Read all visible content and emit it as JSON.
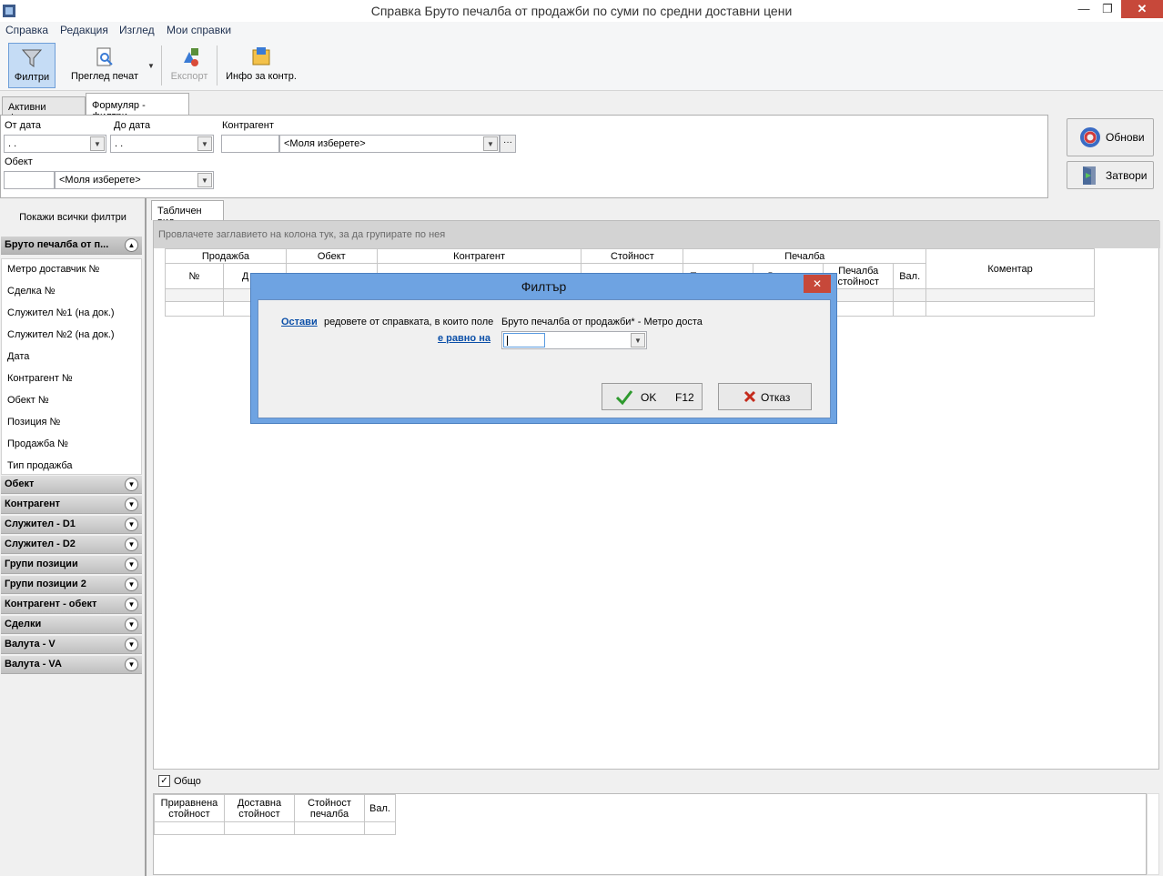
{
  "window": {
    "title": "Справка Бруто печалба от продажби по суми по средни доставни цени"
  },
  "menu": [
    "Справка",
    "Редакция",
    "Изглед",
    "Мои справки"
  ],
  "toolbar": {
    "filters": "Филтри",
    "print_preview": "Преглед печат",
    "export": "Експорт",
    "info": "Инфо за контр."
  },
  "tabs": {
    "active_filters": "Активни филтри",
    "form_filters": "Формуляр - филтри"
  },
  "form": {
    "from_date_label": "От дата",
    "from_date_value": " .  .",
    "to_date_label": "До дата",
    "to_date_value": " .  .",
    "partner_label": "Контрагент",
    "partner_value": "<Моля изберете>",
    "object_label": "Обект",
    "object_value": "<Моля изберете>"
  },
  "buttons": {
    "refresh": "Обнови",
    "close": "Затвори"
  },
  "left": {
    "show_all": "Покажи всички филтри",
    "expanded_group": "Бруто печалба от п...",
    "items": [
      "Метро доставчик №",
      "Сделка №",
      "Служител №1 (на док.)",
      "Служител №2 (на док.)",
      "Дата",
      "Контрагент №",
      "Обект №",
      "Позиция №",
      "Продажба №",
      "Тип продажба"
    ],
    "groups": [
      "Обект",
      "Контрагент",
      "Служител - D1",
      "Служител - D2",
      "Групи позиции",
      "Групи позиции 2",
      "Контрагент - обект",
      "Сделки",
      "Валута - V",
      "Валута - VA"
    ]
  },
  "grid": {
    "tab": "Табличен вид",
    "group_hint": "Провлачете заглавието на колона тук, за да групирате по нея",
    "h_sale": "Продажба",
    "h_object": "Обект",
    "h_partner": "Контрагент",
    "h_value": "Стойност",
    "h_profit": "Печалба",
    "h_comment": "Коментар",
    "h_no": "№",
    "h_d": "Д",
    "h_eq": "Приравнена",
    "h_deliv": "Доставна",
    "h_profit_value": "Печалба стойност",
    "h_cur": "Вал."
  },
  "dialog": {
    "title": "Филтър",
    "keep": "Остави",
    "text": "редовете от справката, в които поле",
    "field": "Бруто печалба от продажби* - Метро доста",
    "equals": "е равно на",
    "ok": "OK",
    "ok_key": "F12",
    "cancel": "Отказ"
  },
  "summary": {
    "total": "Общо",
    "c1": "Приравнена стойност",
    "c2": "Доставна стойност",
    "c3": "Стойност печалба",
    "c4": "Вал."
  }
}
